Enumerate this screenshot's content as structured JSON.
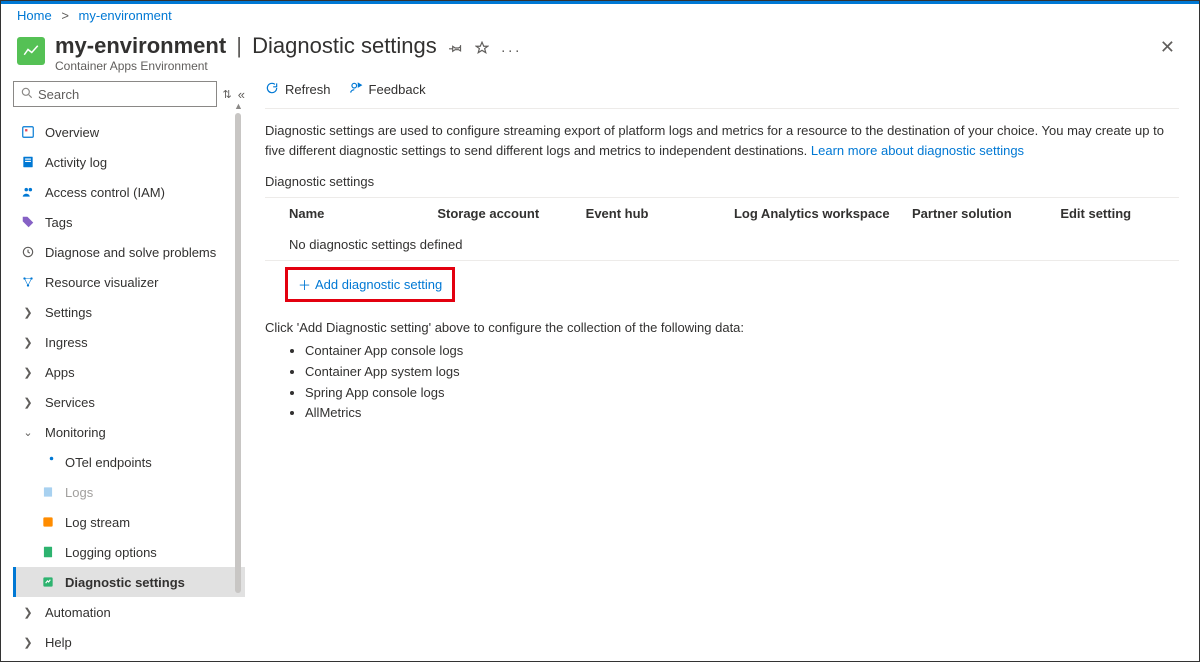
{
  "breadcrumb": {
    "home": "Home",
    "resource": "my-environment"
  },
  "header": {
    "name": "my-environment",
    "page": "Diagnostic settings",
    "subtitle": "Container Apps Environment"
  },
  "search": {
    "placeholder": "Search"
  },
  "nav": {
    "overview": "Overview",
    "activity": "Activity log",
    "iam": "Access control (IAM)",
    "tags": "Tags",
    "diag": "Diagnose and solve problems",
    "resvis": "Resource visualizer",
    "settings": "Settings",
    "ingress": "Ingress",
    "apps": "Apps",
    "services": "Services",
    "monitoring": "Monitoring",
    "otel": "OTel endpoints",
    "logs": "Logs",
    "logstream": "Log stream",
    "logopts": "Logging options",
    "diagset": "Diagnostic settings",
    "automation": "Automation",
    "help": "Help"
  },
  "toolbar": {
    "refresh": "Refresh",
    "feedback": "Feedback"
  },
  "main": {
    "description": "Diagnostic settings are used to configure streaming export of platform logs and metrics for a resource to the destination of your choice. You may create up to five different diagnostic settings to send different logs and metrics to independent destinations. ",
    "learn_link": "Learn more about diagnostic settings",
    "section_label": "Diagnostic settings",
    "columns": {
      "name": "Name",
      "storage": "Storage account",
      "event": "Event hub",
      "law": "Log Analytics workspace",
      "partner": "Partner solution",
      "edit": "Edit setting"
    },
    "empty": "No diagnostic settings defined",
    "add_label": "Add diagnostic setting",
    "hint": "Click 'Add Diagnostic setting' above to configure the collection of the following data:",
    "bullets": [
      "Container App console logs",
      "Container App system logs",
      "Spring App console logs",
      "AllMetrics"
    ]
  }
}
